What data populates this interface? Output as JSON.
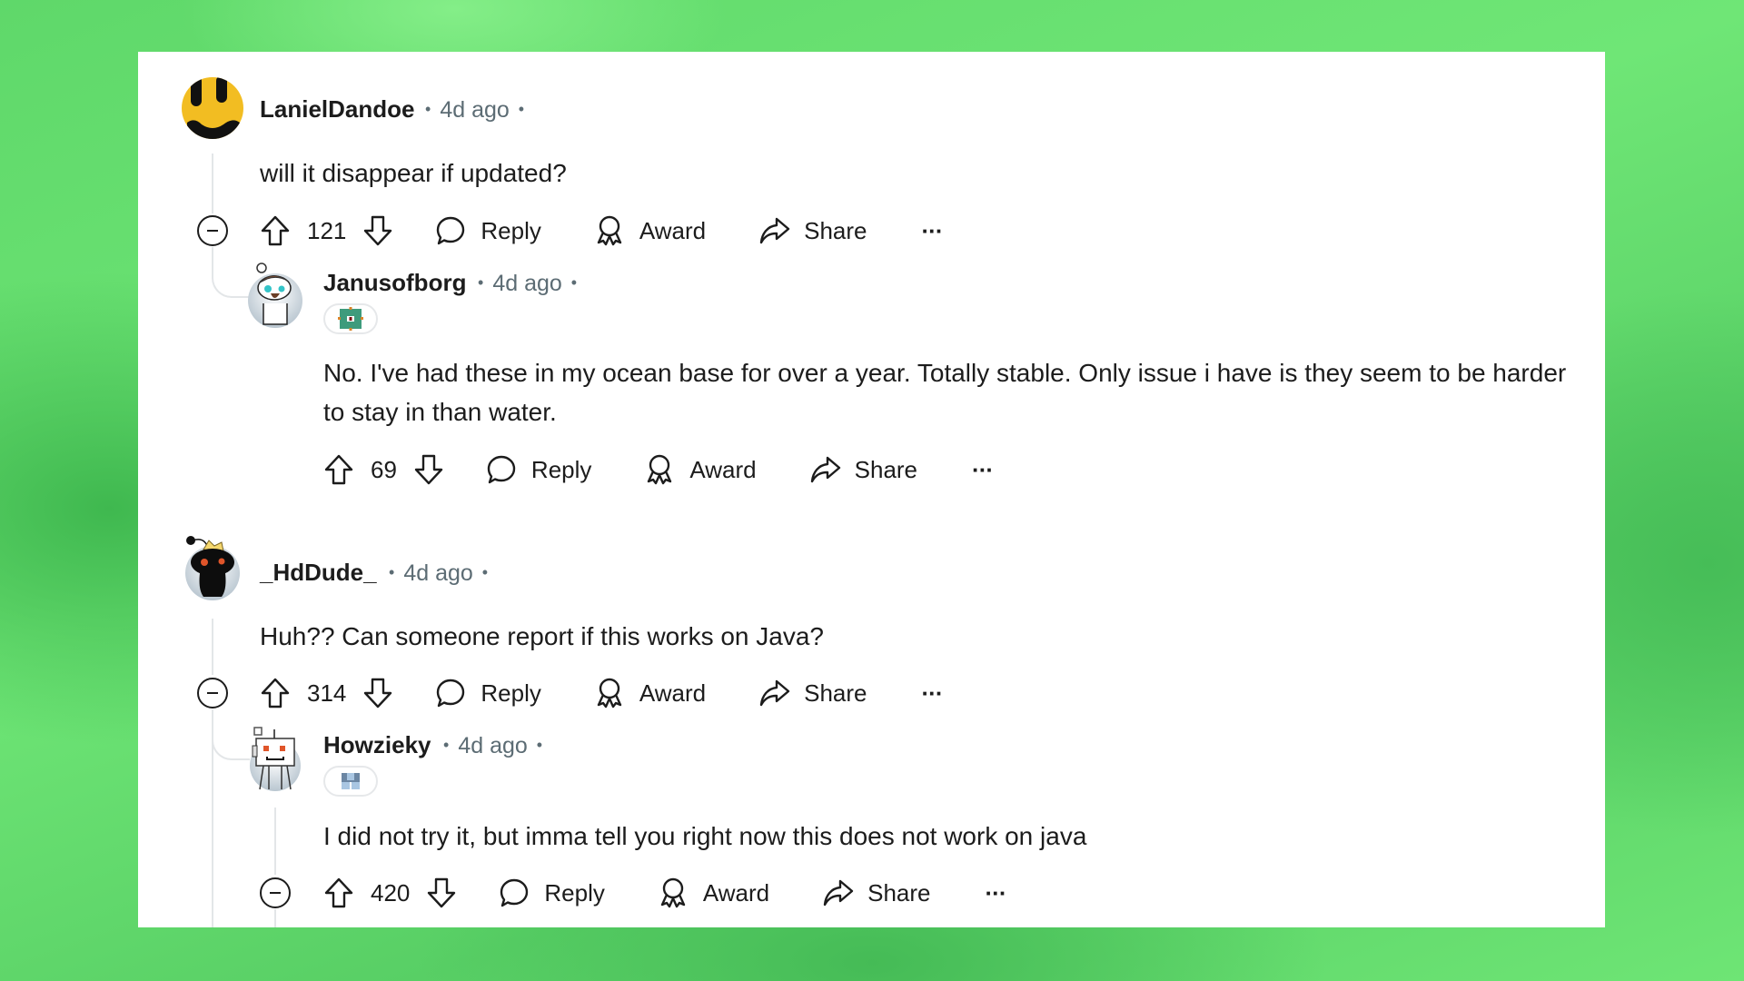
{
  "comments": [
    {
      "username": "LanielDandoe",
      "timestamp": "4d ago",
      "body": "will it disappear if updated?",
      "score": "121",
      "avatar": "yellow-smiley-avatar",
      "actions": {
        "reply": "Reply",
        "award": "Award",
        "share": "Share",
        "more": "···"
      },
      "replies": [
        {
          "username": "Janusofborg",
          "timestamp": "4d ago",
          "flair": "green-block-flair",
          "body": "No. I've had these in my ocean base for over a year. Totally stable. Only issue i have is they seem to be harder to stay in than water.",
          "score": "69",
          "avatar": "snoo-beanie-avatar",
          "actions": {
            "reply": "Reply",
            "award": "Award",
            "share": "Share",
            "more": "···"
          }
        }
      ]
    },
    {
      "username": "_HdDude_",
      "timestamp": "4d ago",
      "body": "Huh?? Can someone report if this works on Java?",
      "score": "314",
      "avatar": "dark-snoo-avatar",
      "actions": {
        "reply": "Reply",
        "award": "Award",
        "share": "Share",
        "more": "···"
      },
      "replies": [
        {
          "username": "Howzieky",
          "timestamp": "4d ago",
          "flair": "blue-block-flair",
          "body": "I did not try it, but imma tell you right now this does not work on java",
          "score": "420",
          "avatar": "robot-snoo-avatar",
          "actions": {
            "reply": "Reply",
            "award": "Award",
            "share": "Share",
            "more": "···"
          }
        }
      ]
    }
  ],
  "colors": {
    "text": "#1c1c1c",
    "meta": "#5c6c74",
    "thread_line": "#e3e6e8",
    "background_green": "#6fe676"
  }
}
